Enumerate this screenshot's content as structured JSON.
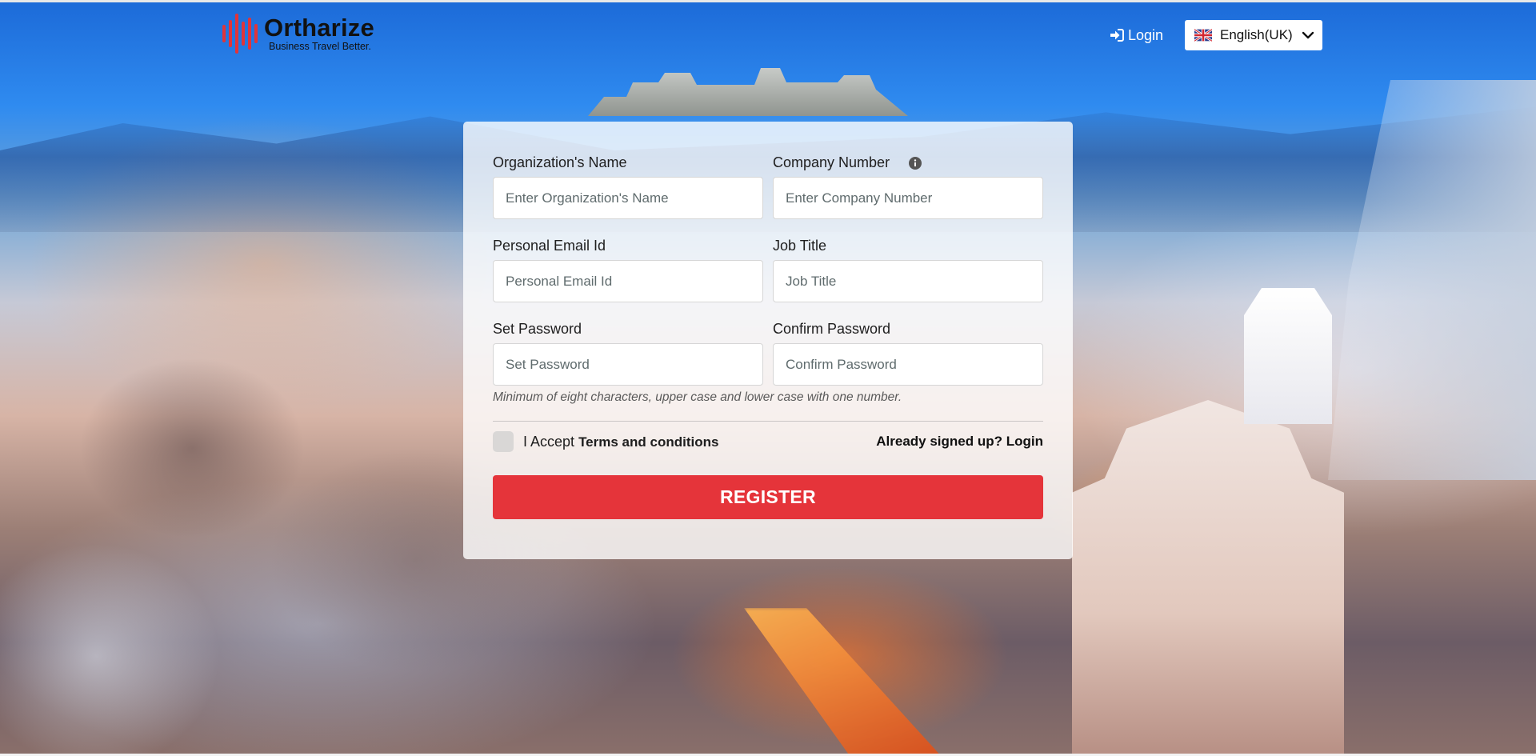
{
  "brand": {
    "name": "Ortharize",
    "tagline": "Business Travel Better."
  },
  "header": {
    "login_label": "Login",
    "language_label": "English(UK)"
  },
  "form": {
    "organization_name": {
      "label": "Organization's Name",
      "placeholder": "Enter Organization's Name",
      "value": ""
    },
    "company_number": {
      "label": "Company Number",
      "placeholder": "Enter Company Number",
      "value": ""
    },
    "personal_email": {
      "label": "Personal Email Id",
      "placeholder": "Personal Email Id",
      "value": ""
    },
    "job_title": {
      "label": "Job Title",
      "placeholder": "Job Title",
      "value": ""
    },
    "set_password": {
      "label": "Set Password",
      "placeholder": "Set Password",
      "value": ""
    },
    "confirm_password": {
      "label": "Confirm Password",
      "placeholder": "Confirm Password",
      "value": ""
    },
    "password_hint": "Minimum of eight characters, upper case and lower case with one number.",
    "accept_prefix": "I Accept",
    "terms_label": "Terms and conditions",
    "terms_checked": false,
    "already_signed_up": "Already signed up? Login",
    "register_label": "REGISTER"
  },
  "colors": {
    "accent": "#e5343a",
    "sky": "#2f8bf0",
    "panel": "rgba(255,255,255,0.80)"
  },
  "icons": {
    "login": "sign-in-icon",
    "language": "uk-flag-icon",
    "dropdown": "chevron-down-icon",
    "info": "info-icon"
  }
}
